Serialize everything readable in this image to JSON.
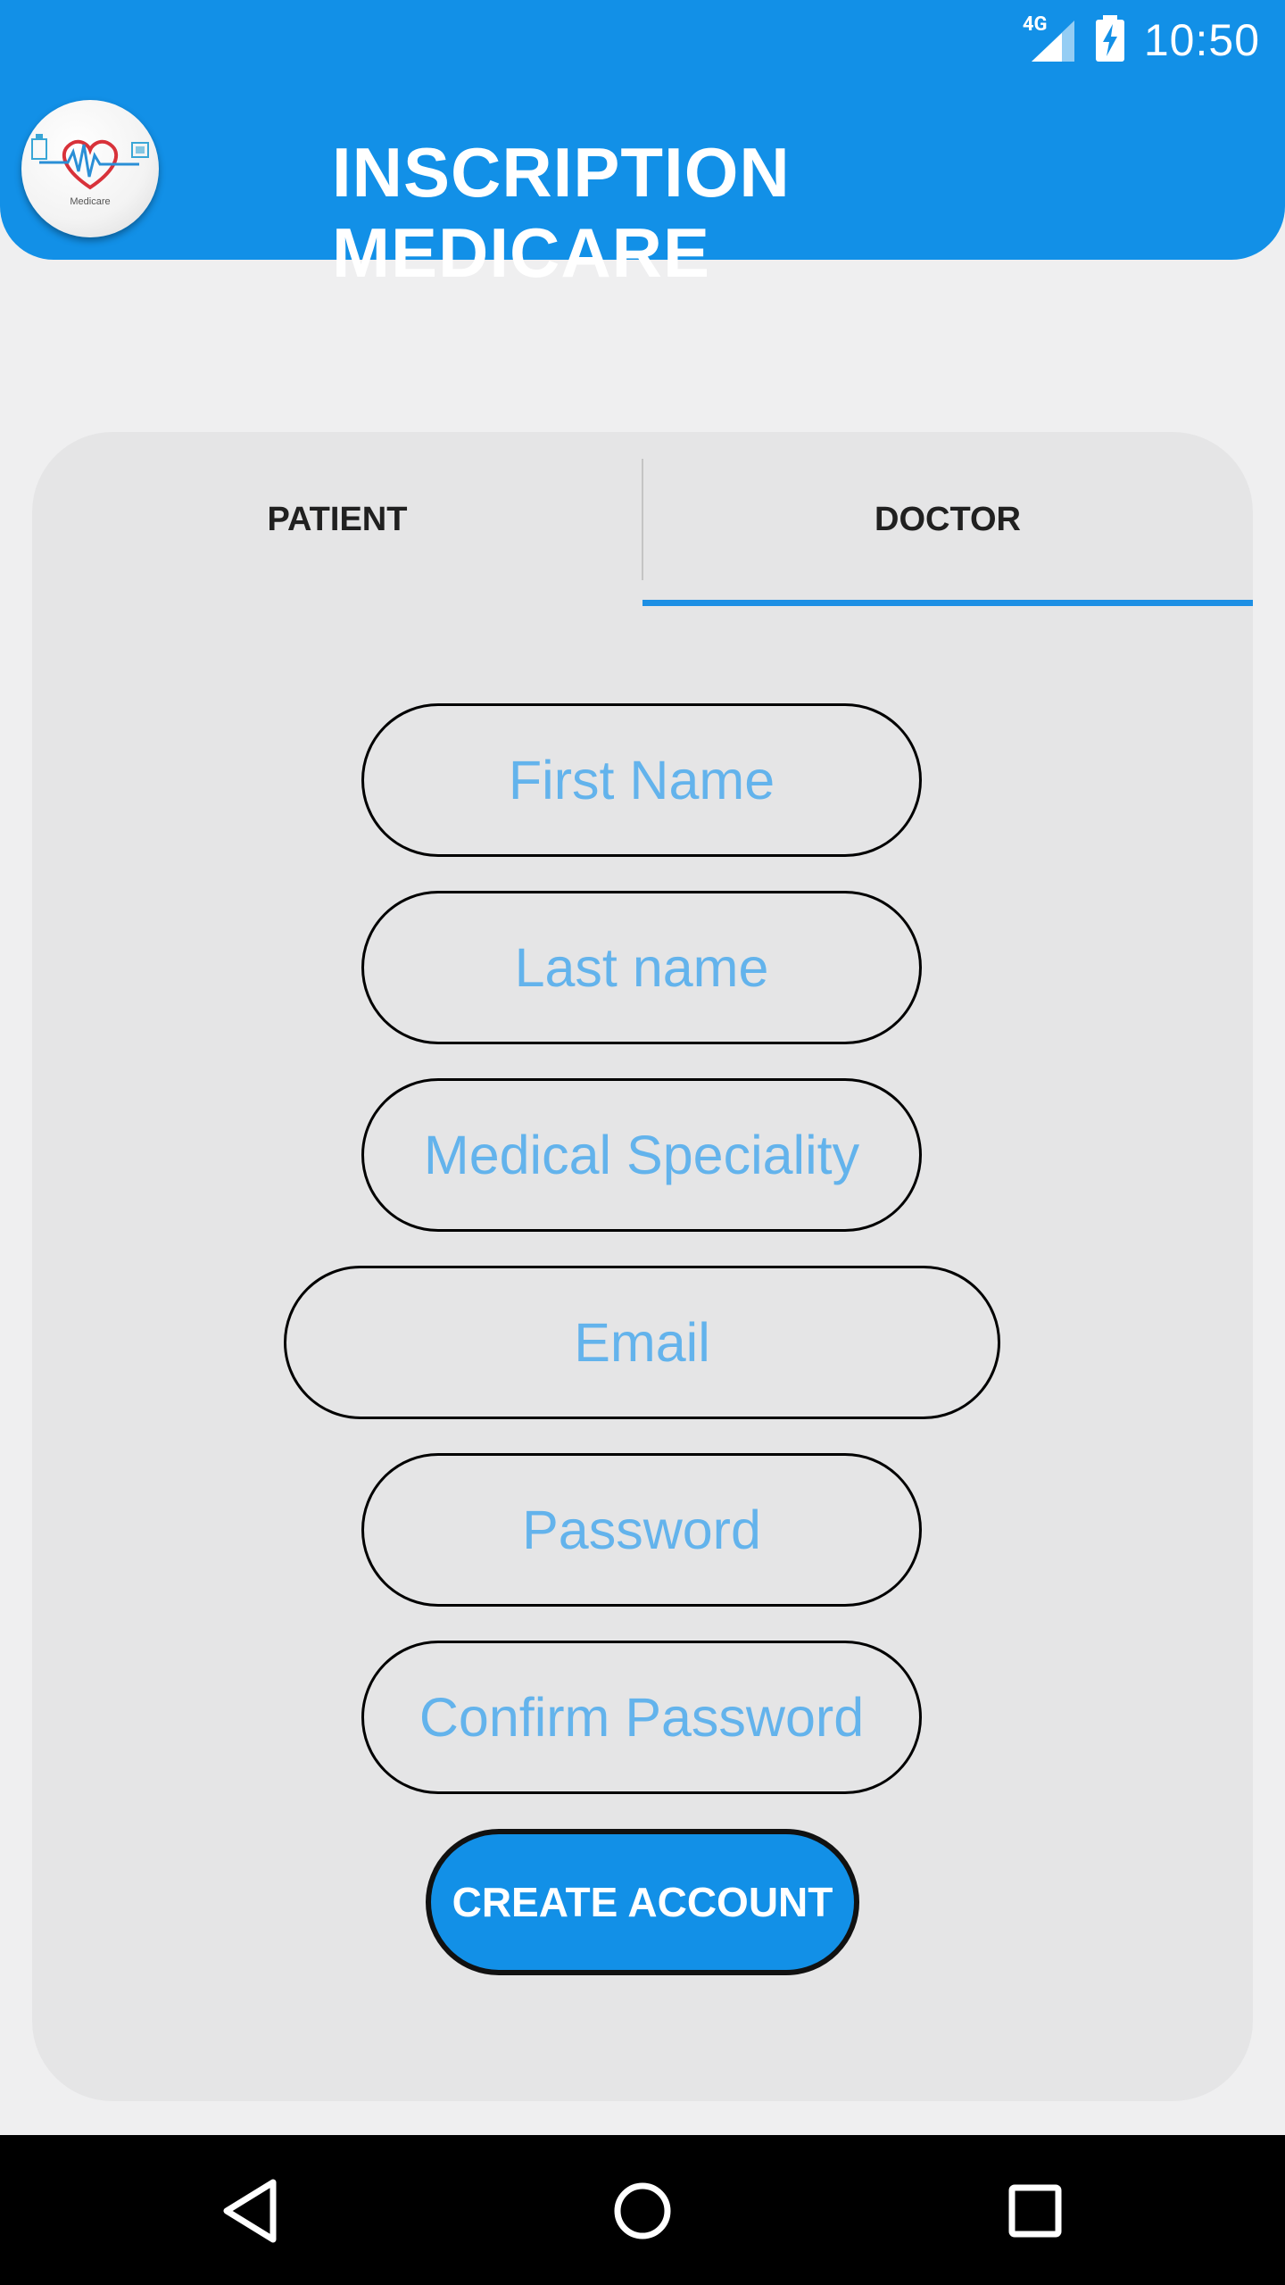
{
  "status_bar": {
    "time": "10:50",
    "network": "4G"
  },
  "header": {
    "title": "INSCRIPTION MEDICARE",
    "logo_caption": "Medicare",
    "background_color": "#1290e7"
  },
  "tabs": [
    {
      "label": "PATIENT",
      "selected": false
    },
    {
      "label": "DOCTOR",
      "selected": true
    }
  ],
  "form": {
    "first_name": {
      "placeholder": "First Name",
      "value": ""
    },
    "last_name": {
      "placeholder": "Last name",
      "value": ""
    },
    "speciality": {
      "placeholder": "Medical Speciality",
      "value": ""
    },
    "email": {
      "placeholder": "Email",
      "value": ""
    },
    "password": {
      "placeholder": "Password",
      "value": ""
    },
    "confirm_password": {
      "placeholder": "Confirm Password",
      "value": ""
    },
    "submit_label": "CREATE ACCOUNT"
  },
  "nav": {
    "back": "back-icon",
    "home": "home-icon",
    "recents": "recents-icon"
  }
}
